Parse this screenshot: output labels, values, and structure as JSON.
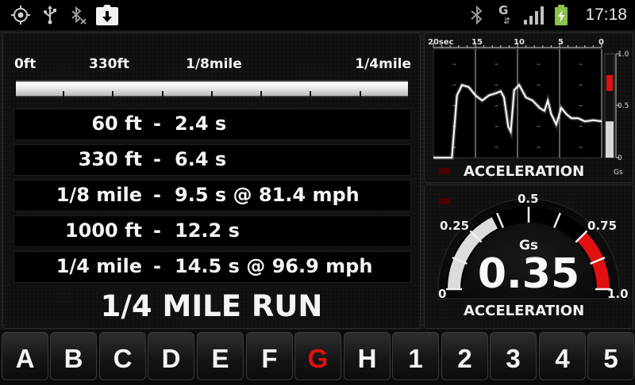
{
  "status_bar": {
    "time": "17:18",
    "icons": [
      "gps-icon",
      "usb-icon",
      "bluetooth-muted-icon",
      "download-icon",
      "bluetooth-icon",
      "gprs-g-icon",
      "signal-icon",
      "battery-charging-icon"
    ],
    "network_type": "G"
  },
  "progress": {
    "labels": [
      "0ft",
      "330ft",
      "1/8mile",
      "1/4mile"
    ],
    "fill_fraction": 1.0
  },
  "results": [
    {
      "distance": "60 ft",
      "separator": "-",
      "result": "2.4 s"
    },
    {
      "distance": "330 ft",
      "separator": "-",
      "result": "6.4 s"
    },
    {
      "distance": "1/8 mile",
      "separator": "-",
      "result": "9.5 s @ 81.4 mph"
    },
    {
      "distance": "1000 ft",
      "separator": "-",
      "result": "12.2 s"
    },
    {
      "distance": "1/4 mile",
      "separator": "-",
      "result": "14.5 s @ 96.9 mph"
    }
  ],
  "run_title": "1/4 MILE RUN",
  "graph": {
    "time_labels": [
      "20sec",
      "15",
      "10",
      "5",
      "0"
    ],
    "scale_labels": [
      "1.0",
      "0.5",
      "0"
    ],
    "unit": "Gs",
    "label": "ACCELERATION",
    "trace": [
      [
        20,
        0
      ],
      [
        17.8,
        0
      ],
      [
        17.2,
        0.6
      ],
      [
        16.6,
        0.7
      ],
      [
        15.8,
        0.68
      ],
      [
        15.0,
        0.6
      ],
      [
        14.2,
        0.55
      ],
      [
        13.4,
        0.6
      ],
      [
        12.6,
        0.62
      ],
      [
        12.0,
        0.64
      ],
      [
        11.6,
        0.58
      ],
      [
        11.1,
        0.3
      ],
      [
        10.8,
        0.25
      ],
      [
        10.4,
        0.65
      ],
      [
        9.8,
        0.7
      ],
      [
        9.0,
        0.58
      ],
      [
        8.2,
        0.55
      ],
      [
        7.4,
        0.48
      ],
      [
        6.8,
        0.45
      ],
      [
        6.4,
        0.55
      ],
      [
        6.0,
        0.42
      ],
      [
        5.4,
        0.32
      ],
      [
        4.8,
        0.48
      ],
      [
        4.2,
        0.42
      ],
      [
        3.6,
        0.38
      ],
      [
        2.8,
        0.38
      ],
      [
        2.0,
        0.35
      ],
      [
        1.0,
        0.36
      ],
      [
        0,
        0.35
      ]
    ],
    "bar_level": 0.35,
    "bar_peak": 0.72
  },
  "gauge": {
    "value": "0.35",
    "value_num": 0.35,
    "unit": "Gs",
    "label": "ACCELERATION",
    "min_label": "0",
    "max_label": "1.0",
    "tick_labels": [
      "0.25",
      "0.5",
      "0.75"
    ],
    "red_zone_start": 0.75
  },
  "keys": [
    {
      "label": "A",
      "active": false
    },
    {
      "label": "B",
      "active": false
    },
    {
      "label": "C",
      "active": false
    },
    {
      "label": "D",
      "active": false
    },
    {
      "label": "E",
      "active": false
    },
    {
      "label": "F",
      "active": false
    },
    {
      "label": "G",
      "active": true
    },
    {
      "label": "H",
      "active": false
    },
    {
      "label": "1",
      "active": false
    },
    {
      "label": "2",
      "active": false
    },
    {
      "label": "3",
      "active": false
    },
    {
      "label": "4",
      "active": false
    },
    {
      "label": "5",
      "active": false
    }
  ],
  "colors": {
    "accent_red": "#e01010",
    "text": "#f4f4f4",
    "background": "#151515"
  }
}
